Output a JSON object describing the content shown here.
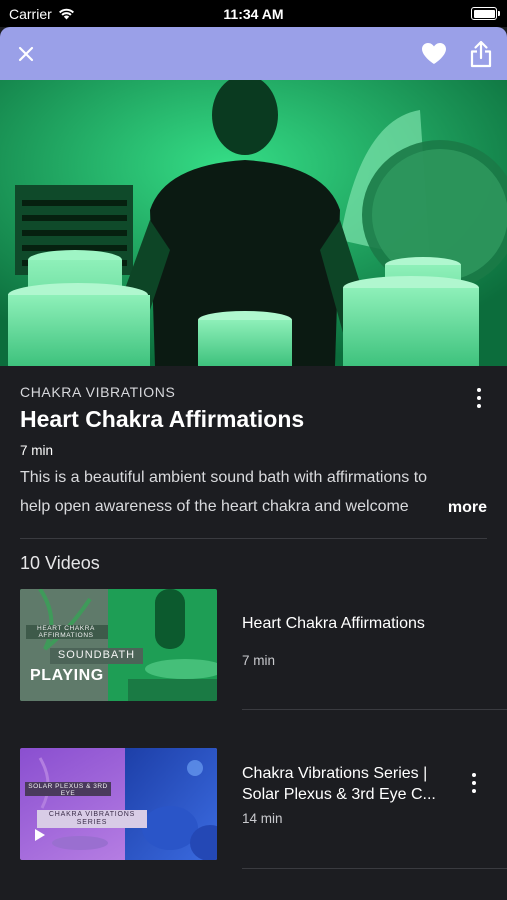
{
  "status_bar": {
    "carrier": "Carrier",
    "time": "11:34 AM"
  },
  "header": {
    "close_icon": "close-icon",
    "heart_icon": "heart-icon",
    "share_icon": "share-icon",
    "color": "#9aa0e8"
  },
  "details": {
    "category": "CHAKRA VIBRATIONS",
    "title": "Heart Chakra Affirmations",
    "duration": "7 min",
    "description": "This is a beautiful ambient sound bath with affirmations to help open awareness of the heart chakra and welcome",
    "more_label": "more"
  },
  "videos": {
    "count_label": "10 Videos",
    "items": [
      {
        "title": "Heart Chakra Affirmations",
        "duration": "7 min",
        "thumb_caption": "HEART CHAKRA AFFIRMATIONS",
        "thumb_tag": "SOUNDBATH",
        "status": "PLAYING"
      },
      {
        "title": "Chakra Vibrations Series | Solar Plexus & 3rd Eye C...",
        "duration": "14 min",
        "thumb_caption": "SOLAR PLEXUS & 3RD EYE",
        "thumb_tag": "CHAKRA VIBRATIONS SERIES"
      }
    ]
  }
}
